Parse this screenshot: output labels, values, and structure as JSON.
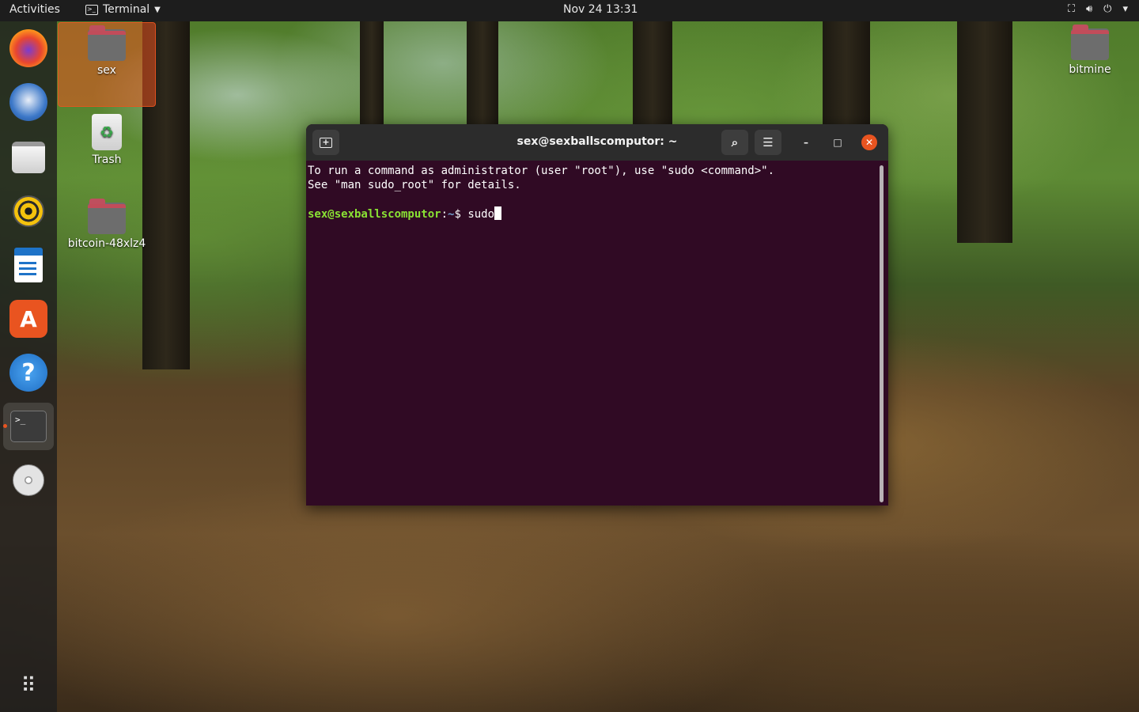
{
  "topbar": {
    "activities": "Activities",
    "app_name": "Terminal",
    "clock": "Nov 24  13:31",
    "tray_icons": [
      "network-icon",
      "volume-icon",
      "power-icon",
      "menu-caret-icon"
    ]
  },
  "dock": {
    "items": [
      "firefox-icon",
      "thunderbird-icon",
      "files-icon",
      "rhythmbox-icon",
      "writer-icon",
      "software-center-icon",
      "help-icon",
      "terminal-icon",
      "dvd-icon",
      "show-apps-icon"
    ],
    "active_item": "terminal-icon",
    "running_indicator_color": "#e95420"
  },
  "desktop": {
    "icons": [
      {
        "label": "sex"
      },
      {
        "label": "Trash"
      },
      {
        "label": "bitcoin-48xlz4"
      },
      {
        "label": "bitmine"
      }
    ]
  },
  "terminal": {
    "title": "sex@sexballscomputor: ~",
    "line1": "To run a command as administrator (user \"root\"), use \"sudo <command>\".",
    "line2": "See \"man sudo_root\" for details.",
    "prompt_user": "sex@sexballscomputor",
    "prompt_sep": ":",
    "prompt_path": "~",
    "prompt_symbol": "$ ",
    "input": "sudo",
    "colors": {
      "background": "#300a24",
      "prompt_user": "#8ae234",
      "prompt_path": "#729fcf",
      "close": "#e95420"
    }
  }
}
